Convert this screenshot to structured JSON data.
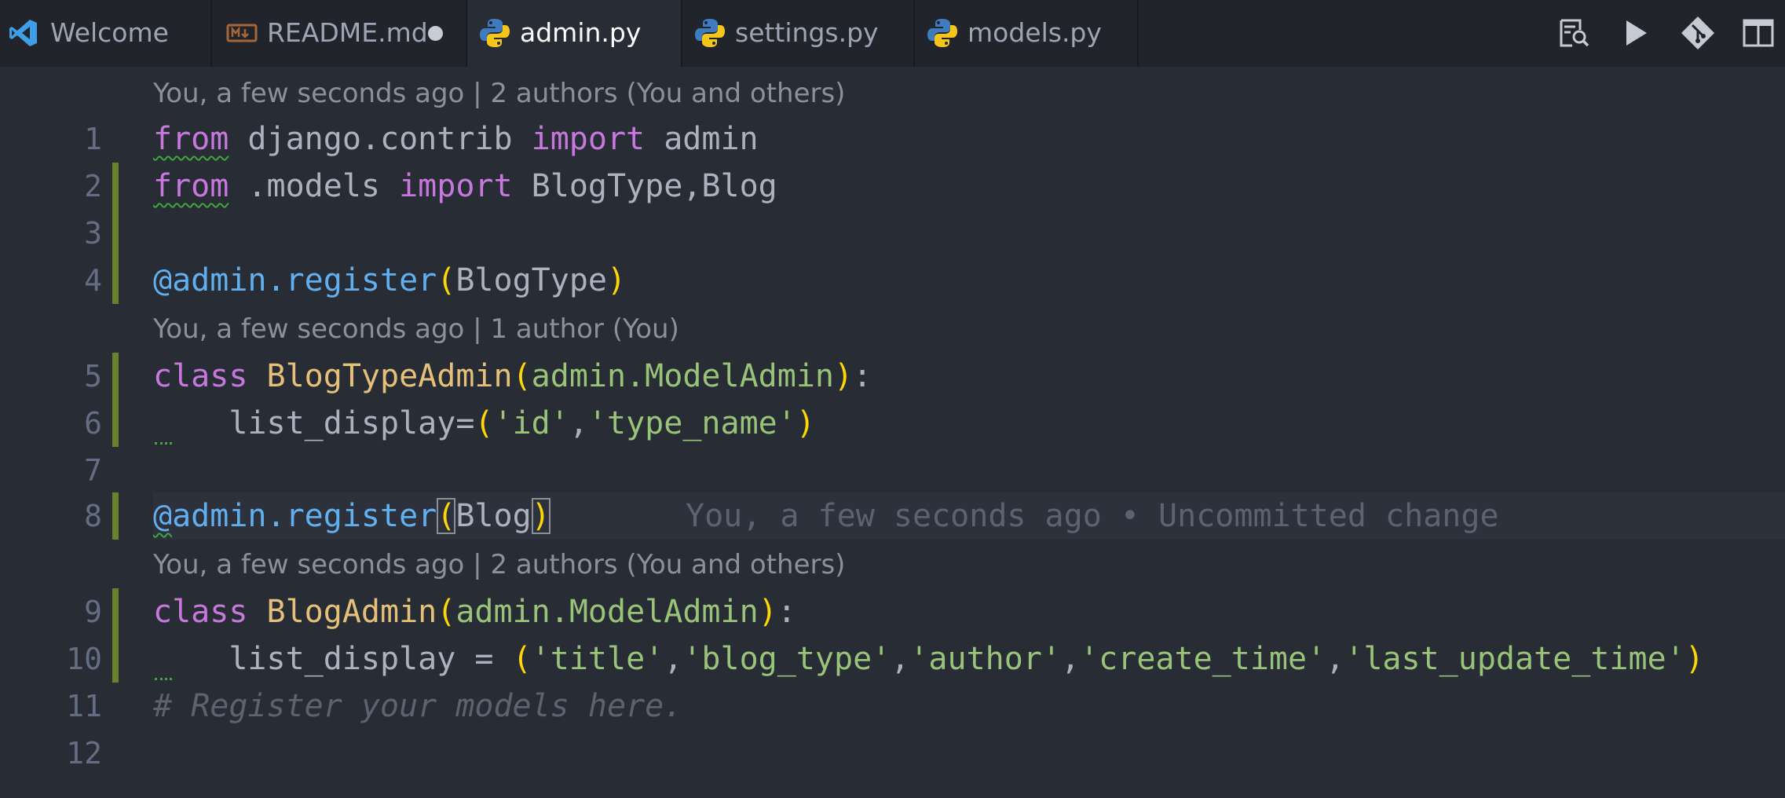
{
  "colors": {
    "tabbar_bg": "#21252b",
    "editor_bg": "#282c34",
    "keyword": "#c678dd",
    "function": "#61afef",
    "class": "#e5c07b",
    "string": "#98c379",
    "bracket": "#ffd700",
    "comment": "#5c6370",
    "git_modified_bar": "#69822c"
  },
  "tabs": [
    {
      "label": "Welcome",
      "icon": "vscode-icon",
      "active": false,
      "dirty": false
    },
    {
      "label": "README.md",
      "icon": "markdown-icon",
      "active": false,
      "dirty": true
    },
    {
      "label": "admin.py",
      "icon": "python-icon",
      "active": true,
      "dirty": false
    },
    {
      "label": "settings.py",
      "icon": "python-icon",
      "active": false,
      "dirty": false
    },
    {
      "label": "models.py",
      "icon": "python-icon",
      "active": false,
      "dirty": false
    }
  ],
  "actions": [
    "find-in-preview-icon",
    "run-icon",
    "git-compare-icon",
    "split-editor-icon"
  ],
  "codelens": {
    "top": "You, a few seconds ago | 2 authors (You and others)",
    "blogtype": "You, a few seconds ago | 1 author (You)",
    "blog": "You, a few seconds ago | 2 authors (You and others)"
  },
  "line_numbers": [
    "1",
    "2",
    "3",
    "4",
    "5",
    "6",
    "7",
    "8",
    "9",
    "10",
    "11",
    "12"
  ],
  "code": {
    "l1": {
      "kw1": "from",
      "mod": " django.contrib ",
      "kw2": "import",
      "name": " admin"
    },
    "l2": {
      "kw1": "from",
      "mod": " .models ",
      "kw2": "import",
      "names": " BlogType,Blog"
    },
    "l4": {
      "deco": "@admin.register",
      "open": "(",
      "arg": "BlogType",
      "close": ")"
    },
    "l5": {
      "kw": "class",
      "name": " BlogTypeAdmin",
      "open": "(",
      "base_mod": "admin.",
      "base": "ModelAdmin",
      "close": ")",
      "colon": ":"
    },
    "l6": {
      "attr": "    list_display=",
      "open": "(",
      "s1": "'id'",
      "comma": ",",
      "s2": "'type_name'",
      "close": ")"
    },
    "l8": {
      "at": "@",
      "deco": "admin.register",
      "open": "(",
      "arg": "Blog",
      "close": ")"
    },
    "l9": {
      "kw": "class",
      "name": " BlogAdmin",
      "open": "(",
      "base_mod": "admin.",
      "base": "ModelAdmin",
      "close": ")",
      "colon": ":"
    },
    "l10": {
      "attr": "    list_display = ",
      "open": "(",
      "s1": "'title'",
      "c1": ",",
      "s2": "'blog_type'",
      "c2": ",",
      "s3": "'author'",
      "c3": ",",
      "s4": "'create_time'",
      "c4": ",",
      "s5": "'last_update_time'",
      "close": ")"
    },
    "l11": {
      "comment": "# Register your models here."
    }
  },
  "inline_blame": "You, a few seconds ago • Uncommitted change"
}
